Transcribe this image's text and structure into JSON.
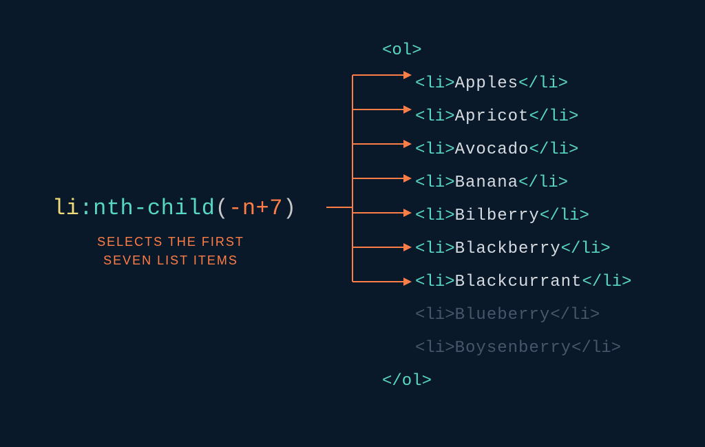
{
  "selector": {
    "tag": "li",
    "pseudo": ":nth-child",
    "open": "(",
    "arg": "-n+7",
    "close": ")"
  },
  "caption": {
    "line1": "SELECTS THE FIRST",
    "line2": "SEVEN LIST ITEMS"
  },
  "code": {
    "open_ol": "<ol>",
    "close_ol": "</ol>",
    "li_open": "<li>",
    "li_close": "</li>",
    "items": [
      "Apples",
      "Apricot",
      "Avocado",
      "Banana",
      "Bilberry",
      "Blackberry",
      "Blackcurrant",
      "Blueberry",
      "Boysenberry"
    ],
    "selected_count": 7
  },
  "colors": {
    "bg": "#0a1929",
    "orange": "#ff7e47",
    "teal": "#57d7c5",
    "yellow": "#f0dd7a",
    "dim": "#48556b"
  }
}
